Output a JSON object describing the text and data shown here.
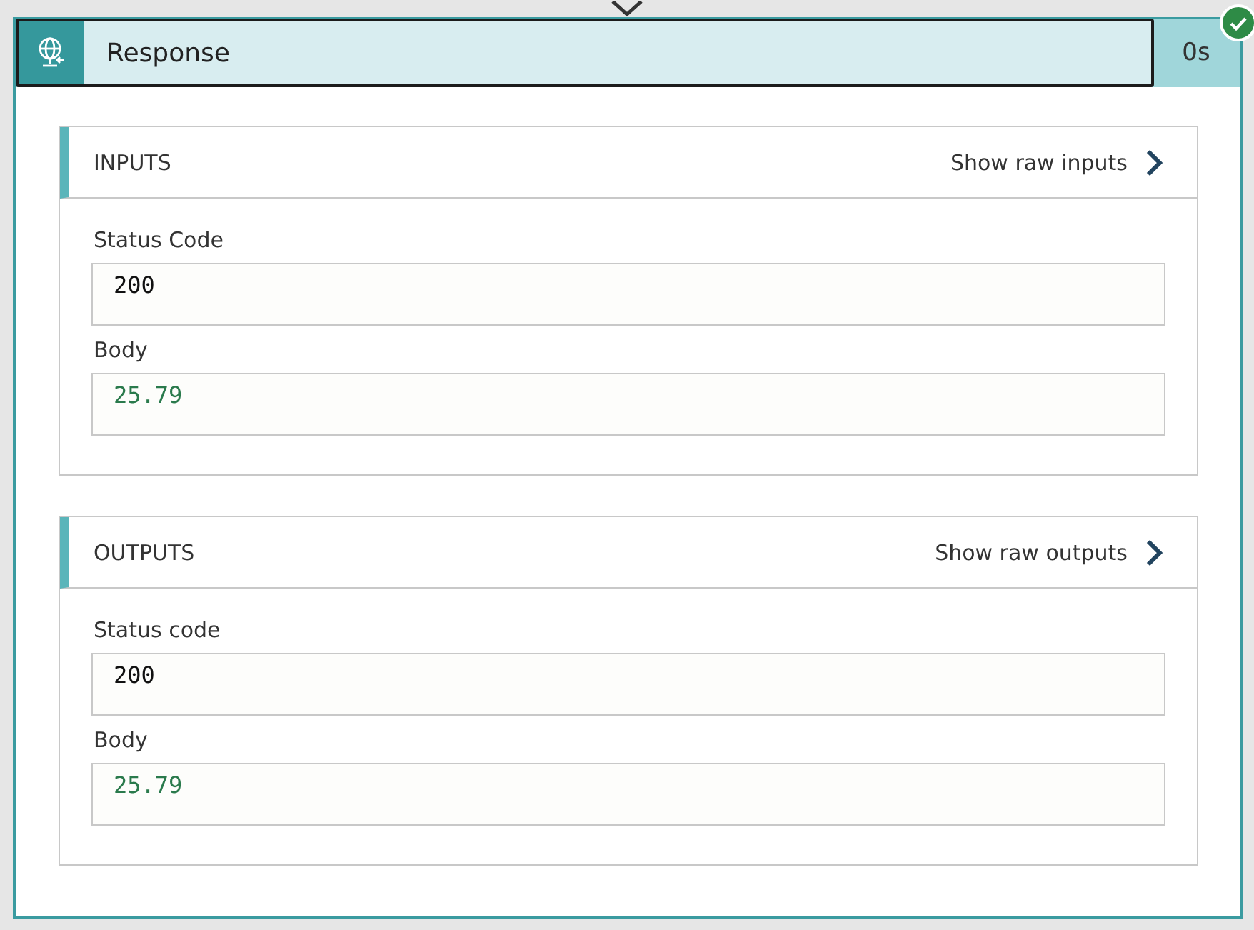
{
  "action": {
    "title": "Response",
    "duration": "0s",
    "succeeded": true
  },
  "sections": [
    {
      "title": "INPUTS",
      "link": "Show raw inputs",
      "fields": [
        {
          "label": "Status Code",
          "value": "200",
          "kind": "plain"
        },
        {
          "label": "Body",
          "value": "25.79",
          "kind": "literal"
        }
      ]
    },
    {
      "title": "OUTPUTS",
      "link": "Show raw outputs",
      "fields": [
        {
          "label": "Status code",
          "value": "200",
          "kind": "plain"
        },
        {
          "label": "Body",
          "value": "25.79",
          "kind": "literal"
        }
      ]
    }
  ]
}
